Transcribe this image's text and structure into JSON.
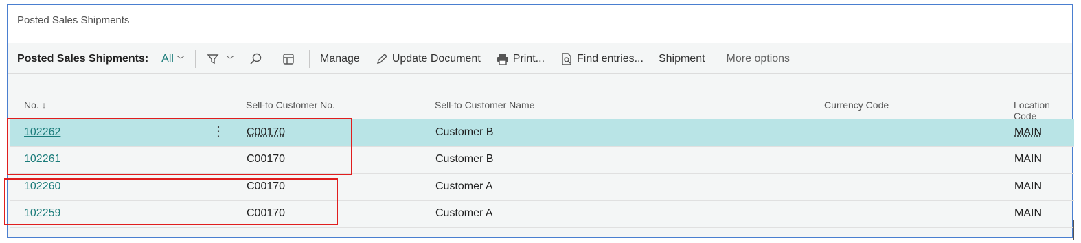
{
  "page": {
    "title": "Posted Sales Shipments"
  },
  "toolbar": {
    "view_label": "Posted Sales Shipments:",
    "filter_value": "All",
    "manage": "Manage",
    "update_document": "Update Document",
    "print": "Print...",
    "find_entries": "Find entries...",
    "shipment": "Shipment",
    "more_options": "More options"
  },
  "columns": {
    "no": "No. ↓",
    "customer_no": "Sell-to Customer No.",
    "customer_name": "Sell-to Customer Name",
    "currency": "Currency Code",
    "location": "Location Code"
  },
  "rows": [
    {
      "no": "102262",
      "customer_no": "C00170",
      "customer_name": "Customer B",
      "location": "MAIN"
    },
    {
      "no": "102261",
      "customer_no": "C00170",
      "customer_name": "Customer B",
      "location": "MAIN"
    },
    {
      "no": "102260",
      "customer_no": "C00170",
      "customer_name": "Customer A",
      "location": "MAIN"
    },
    {
      "no": "102259",
      "customer_no": "C00170",
      "customer_name": "Customer A",
      "location": "MAIN"
    }
  ],
  "colors": {
    "accent": "#1b7c7a",
    "selected_row": "#b9e4e6",
    "highlight": "#e01e1e"
  }
}
